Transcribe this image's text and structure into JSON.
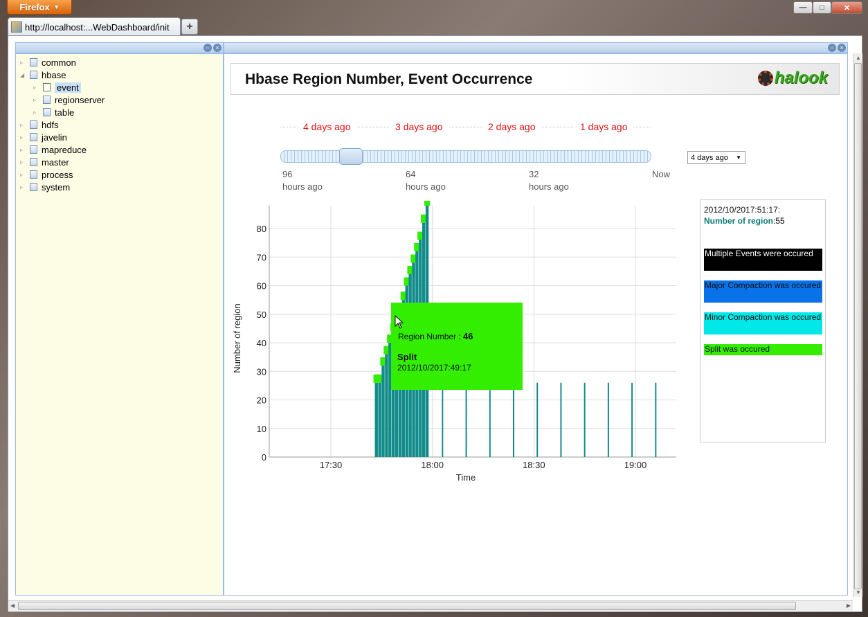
{
  "browser": {
    "app_button": "Firefox",
    "tab_title": "http://localhost:...WebDashboard/init",
    "new_tab": "+",
    "window_controls": {
      "minimize": "—",
      "maximize": "□",
      "close": "✕"
    }
  },
  "sidebar": {
    "items": [
      {
        "label": "common",
        "depth": 0,
        "expanded": false,
        "selected": false
      },
      {
        "label": "hbase",
        "depth": 0,
        "expanded": true,
        "selected": false
      },
      {
        "label": "event",
        "depth": 1,
        "expanded": false,
        "selected": true
      },
      {
        "label": "regionserver",
        "depth": 1,
        "expanded": false,
        "selected": false
      },
      {
        "label": "table",
        "depth": 1,
        "expanded": false,
        "selected": false
      },
      {
        "label": "hdfs",
        "depth": 0,
        "expanded": false,
        "selected": false
      },
      {
        "label": "javelin",
        "depth": 0,
        "expanded": false,
        "selected": false
      },
      {
        "label": "mapreduce",
        "depth": 0,
        "expanded": false,
        "selected": false
      },
      {
        "label": "master",
        "depth": 0,
        "expanded": false,
        "selected": false
      },
      {
        "label": "process",
        "depth": 0,
        "expanded": false,
        "selected": false
      },
      {
        "label": "system",
        "depth": 0,
        "expanded": false,
        "selected": false
      }
    ]
  },
  "header": {
    "title": "Hbase Region Number, Event Occurrence",
    "logo_text": "halook"
  },
  "timeline": {
    "labels": [
      "4 days ago",
      "3 days ago",
      "2 days ago",
      "1 days ago"
    ],
    "label_color": "#e01010",
    "slider_ticks": [
      {
        "value": "96",
        "unit": "hours ago"
      },
      {
        "value": "64",
        "unit": "hours ago"
      },
      {
        "value": "32",
        "unit": "hours ago"
      },
      {
        "value": "Now",
        "unit": ""
      }
    ],
    "range_select": "4 days ago"
  },
  "chart_data": {
    "type": "bar",
    "xlabel": "Time",
    "ylabel": "Number of region",
    "ylim": [
      0,
      88
    ],
    "yticks": [
      "0",
      "10",
      "20",
      "30",
      "40",
      "50",
      "60",
      "70",
      "80"
    ],
    "xticks": [
      "17:30",
      "18:00",
      "18:30",
      "19:00"
    ],
    "grid": true,
    "bar_color": "#128c8a",
    "series": [
      {
        "x": [
          "17:43",
          "17:44",
          "17:45",
          "17:46",
          "17:47",
          "17:48",
          "17:49",
          "17:50",
          "17:51",
          "17:52",
          "17:53",
          "17:54",
          "17:55",
          "17:56",
          "17:57",
          "17:58"
        ],
        "values": [
          26,
          26,
          32,
          36,
          40,
          44,
          46,
          50,
          55,
          60,
          64,
          68,
          72,
          76,
          82,
          88
        ]
      },
      {
        "x": [
          "18:03",
          "18:10",
          "18:17",
          "18:24",
          "18:31",
          "18:38",
          "18:45",
          "18:52",
          "18:59",
          "19:06"
        ],
        "values": [
          26,
          26,
          26,
          26,
          26,
          26,
          26,
          26,
          26,
          26
        ]
      }
    ],
    "event_color": "#33ee00"
  },
  "tooltip": {
    "region_label": "Region Number : ",
    "region_value": "46",
    "event": "Split",
    "time": "2012/10/2017:49:17"
  },
  "legend": {
    "timestamp": "2012/10/2017:51:17:",
    "count_label": "Number of region",
    "count_value": ":55",
    "items": [
      {
        "label": "Multiple Events were occured",
        "bg": "#000000",
        "fg": "#ffffff"
      },
      {
        "label": "Major Compaction was occured",
        "bg": "#0a72e8",
        "fg": "#111111"
      },
      {
        "label": "Minor Compaction was occured",
        "bg": "#00e8e8",
        "fg": "#111111"
      },
      {
        "label": "Split was occured",
        "bg": "#33ee00",
        "fg": "#111111"
      }
    ]
  }
}
